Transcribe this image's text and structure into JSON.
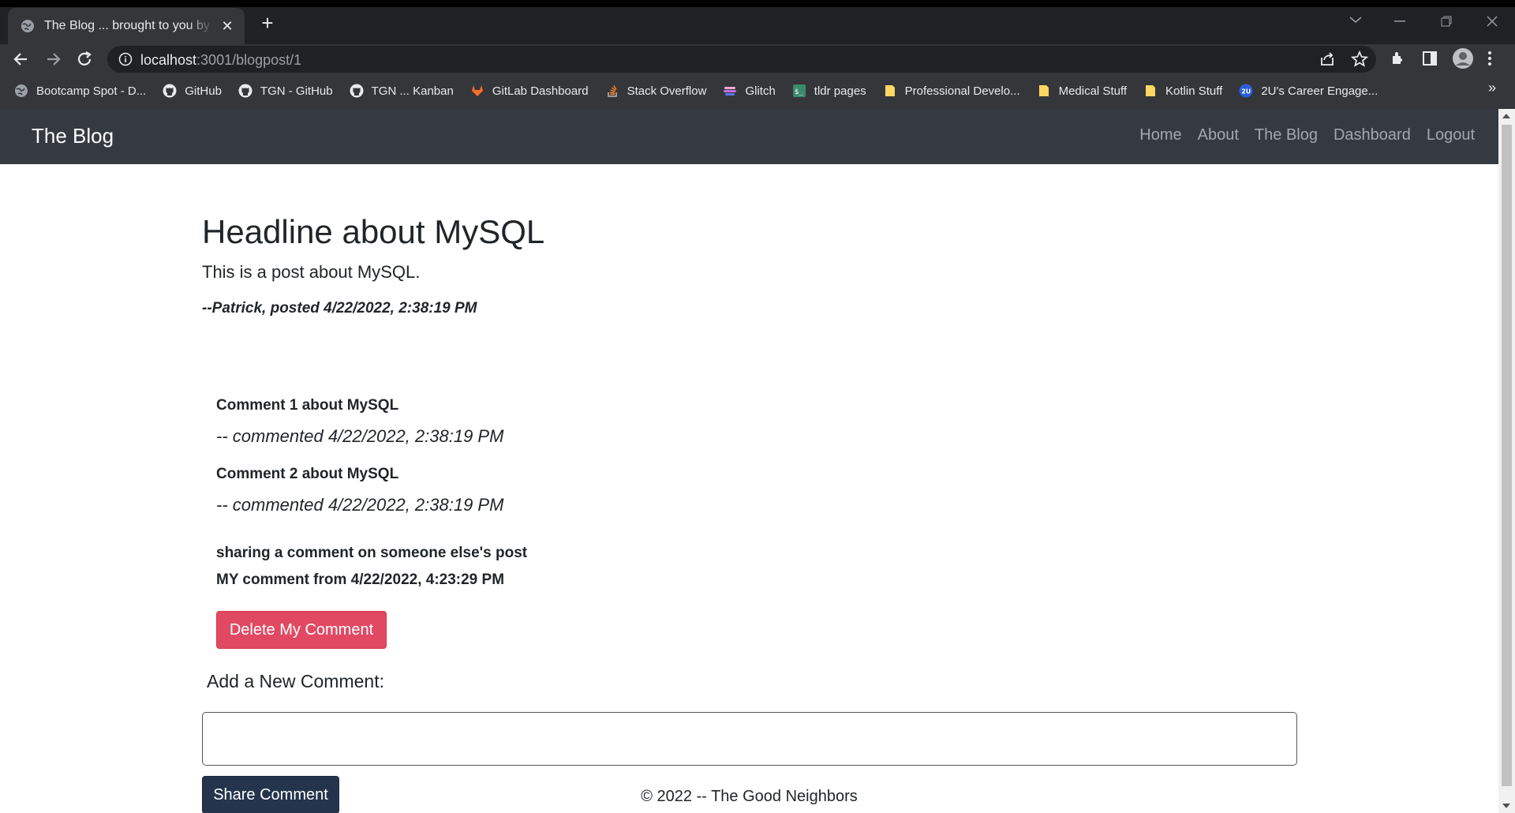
{
  "browser": {
    "tab_title": "The Blog ... brought to you by the Good Neighbors",
    "new_tab": "+",
    "tab_close": "✕",
    "url_host": "localhost",
    "url_rest": ":3001/blogpost/1",
    "bookmarks": [
      {
        "label": "Bootcamp Spot - D...",
        "icon": "globe-icon",
        "color": "#9aa0a6"
      },
      {
        "label": "GitHub",
        "icon": "github-icon",
        "color": "#e8eaed"
      },
      {
        "label": "TGN - GitHub",
        "icon": "github-icon",
        "color": "#e8eaed"
      },
      {
        "label": "TGN ... Kanban",
        "icon": "github-icon",
        "color": "#e8eaed"
      },
      {
        "label": "GitLab Dashboard",
        "icon": "gitlab-icon",
        "color": "#fc6d26"
      },
      {
        "label": "Stack Overflow",
        "icon": "stackoverflow-icon",
        "color": "#f48024"
      },
      {
        "label": "Glitch",
        "icon": "glitch-icon",
        "color": "#c46fd8"
      },
      {
        "label": "tldr pages",
        "icon": "tldr-icon",
        "color": "#3c8a6e"
      },
      {
        "label": "Professional Develo...",
        "icon": "folder-icon",
        "color": "#fdd663"
      },
      {
        "label": "Medical Stuff",
        "icon": "folder-icon",
        "color": "#fdd663"
      },
      {
        "label": "Kotlin Stuff",
        "icon": "folder-icon",
        "color": "#fdd663"
      },
      {
        "label": "2U's Career Engage...",
        "icon": "2u-icon",
        "color": "#2b5fd9"
      }
    ],
    "more_bookmarks": "»"
  },
  "nav": {
    "brand": "The Blog",
    "links": [
      "Home",
      "About",
      "The Blog",
      "Dashboard",
      "Logout"
    ]
  },
  "post": {
    "headline": "Headline about MySQL",
    "body": "This is a post about MySQL.",
    "byline": "--Patrick, posted 4/22/2022, 2:38:19 PM"
  },
  "comments": [
    {
      "text": "Comment 1 about MySQL",
      "meta": "-- commented 4/22/2022, 2:38:19 PM"
    },
    {
      "text": "Comment 2 about MySQL",
      "meta": "-- commented 4/22/2022, 2:38:19 PM"
    },
    {
      "text": "sharing a comment on someone else's post",
      "meta": "MY comment from 4/22/2022, 4:23:29 PM"
    }
  ],
  "actions": {
    "delete_label": "Delete My Comment",
    "add_label": "Add a New Comment:",
    "input_value": "",
    "share_label": "Share Comment"
  },
  "footer": "© 2022 -- The Good Neighbors",
  "colors": {
    "navbar": "#343a40",
    "danger": "#e14963",
    "primary": "#24344d"
  }
}
